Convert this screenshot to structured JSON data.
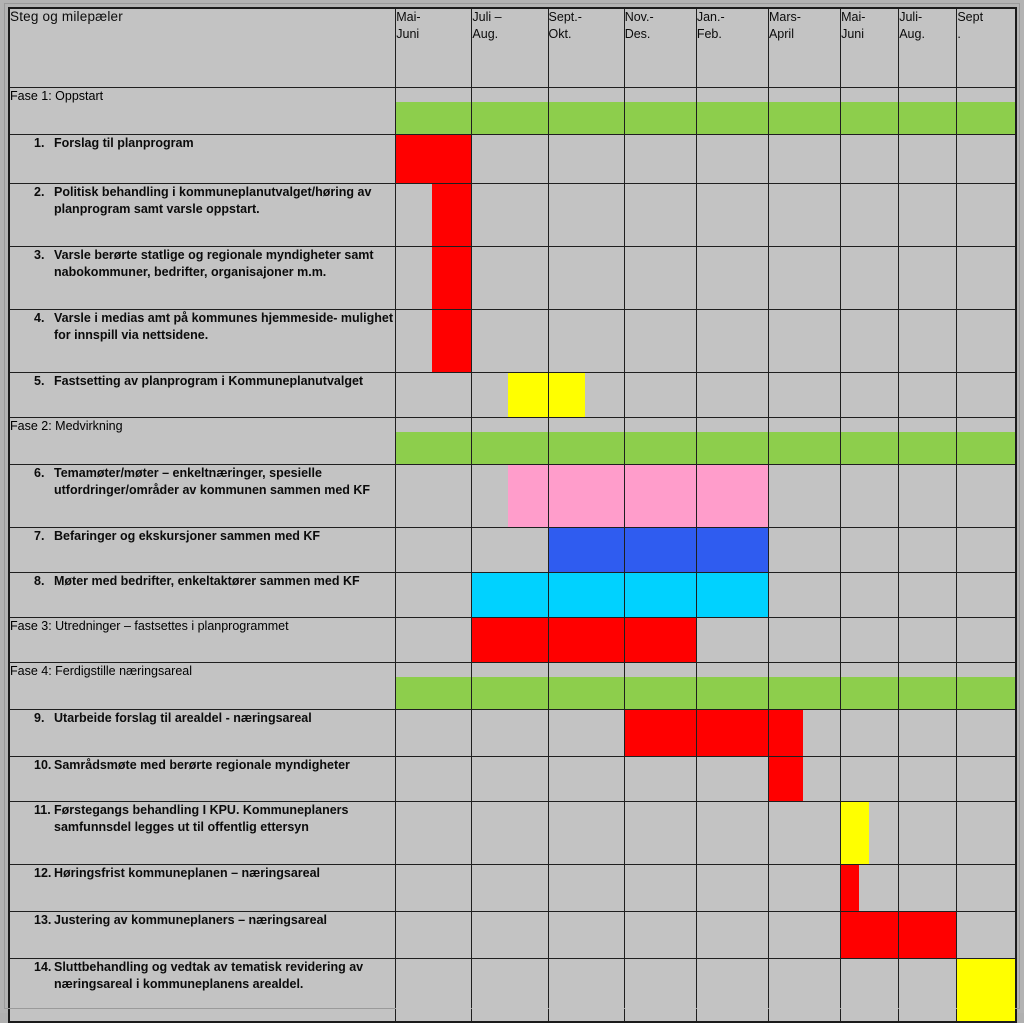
{
  "table": {
    "corner_header": "Steg og milepæler",
    "columns": [
      {
        "line1": "Mai-",
        "line2": "Juni"
      },
      {
        "line1": "Juli –",
        "line2": "Aug."
      },
      {
        "line1": "Sept.-",
        "line2": "Okt."
      },
      {
        "line1": "Nov.-",
        "line2": "Des."
      },
      {
        "line1": "Jan.-",
        "line2": "Feb."
      },
      {
        "line1": "Mars-",
        "line2": "April"
      },
      {
        "line1": "Mai-",
        "line2": "Juni"
      },
      {
        "line1": "Juli-",
        "line2": "Aug."
      },
      {
        "line1": "Sept",
        "line2": "."
      }
    ],
    "rows": [
      {
        "kind": "phase",
        "label": "Fase 1: Oppstart",
        "bars": [
          {
            "col": 1,
            "color": "#8DCE4C",
            "span": "full"
          },
          {
            "col": 2,
            "color": "#8DCE4C",
            "span": "full"
          },
          {
            "col": 3,
            "color": "#8DCE4C",
            "span": "full"
          },
          {
            "col": 4,
            "color": "#8DCE4C",
            "span": "full"
          },
          {
            "col": 5,
            "color": "#8DCE4C",
            "span": "full"
          },
          {
            "col": 6,
            "color": "#8DCE4C",
            "span": "full"
          },
          {
            "col": 7,
            "color": "#8DCE4C",
            "span": "full"
          },
          {
            "col": 8,
            "color": "#8DCE4C",
            "span": "full"
          },
          {
            "col": 9,
            "color": "#8DCE4C",
            "span": "full"
          }
        ]
      },
      {
        "kind": "task",
        "num": "1.",
        "label": "Forslag til planprogram",
        "height": 48,
        "bars": [
          {
            "col": 1,
            "color": "#FF0000",
            "span": "full"
          }
        ]
      },
      {
        "kind": "task",
        "num": "2.",
        "label": "Politisk behandling i kommuneplanutvalget/høring av planprogram samt varsle oppstart.",
        "height": 62,
        "bars": [
          {
            "col": 1,
            "color": "#FF0000",
            "span": "rhalf"
          }
        ]
      },
      {
        "kind": "task",
        "num": "3.",
        "label": "Varsle berørte statlige og regionale myndigheter samt nabokommuner, bedrifter, organisajoner m.m.",
        "height": 62,
        "bars": [
          {
            "col": 1,
            "color": "#FF0000",
            "span": "rhalf"
          }
        ]
      },
      {
        "kind": "task",
        "num": "4.",
        "label": "Varsle i medias amt på kommunes hjemmeside- mulighet for innspill via nettsidene.",
        "height": 62,
        "bars": [
          {
            "col": 1,
            "color": "#FF0000",
            "span": "rhalf"
          }
        ]
      },
      {
        "kind": "task",
        "num": "5.",
        "label": "Fastsetting av planprogram i Kommuneplanutvalget",
        "height": 44,
        "bars": [
          {
            "col": 2,
            "color": "#FFFF00",
            "span": "rhalf"
          },
          {
            "col": 3,
            "color": "#FFFF00",
            "span": "lhalf"
          }
        ]
      },
      {
        "kind": "phase",
        "label": "Fase 2: Medvirkning",
        "bars": [
          {
            "col": 1,
            "color": "#8DCE4C",
            "span": "full"
          },
          {
            "col": 2,
            "color": "#8DCE4C",
            "span": "full"
          },
          {
            "col": 3,
            "color": "#8DCE4C",
            "span": "full"
          },
          {
            "col": 4,
            "color": "#8DCE4C",
            "span": "full"
          },
          {
            "col": 5,
            "color": "#8DCE4C",
            "span": "full"
          },
          {
            "col": 6,
            "color": "#8DCE4C",
            "span": "full"
          },
          {
            "col": 7,
            "color": "#8DCE4C",
            "span": "full"
          },
          {
            "col": 8,
            "color": "#8DCE4C",
            "span": "full"
          },
          {
            "col": 9,
            "color": "#8DCE4C",
            "span": "full"
          }
        ]
      },
      {
        "kind": "task",
        "num": "6.",
        "label": "Temamøter/møter – enkeltnæringer, spesielle utfordringer/områder av kommunen sammen med KF",
        "height": 62,
        "bars": [
          {
            "col": 2,
            "color": "#FF9DCB",
            "span": "rhalf"
          },
          {
            "col": 3,
            "color": "#FF9DCB",
            "span": "full"
          },
          {
            "col": 4,
            "color": "#FF9DCB",
            "span": "full"
          },
          {
            "col": 5,
            "color": "#FF9DCB",
            "span": "full"
          }
        ]
      },
      {
        "kind": "task",
        "num": "7.",
        "label": "Befaringer og ekskursjoner sammen med KF",
        "height": 44,
        "bars": [
          {
            "col": 3,
            "color": "#2F5CF0",
            "span": "full"
          },
          {
            "col": 4,
            "color": "#2F5CF0",
            "span": "full"
          },
          {
            "col": 5,
            "color": "#2F5CF0",
            "span": "full"
          }
        ]
      },
      {
        "kind": "task",
        "num": "8.",
        "label": "Møter med bedrifter, enkeltaktører sammen med KF",
        "height": 44,
        "bars": [
          {
            "col": 2,
            "color": "#00D2FF",
            "span": "full"
          },
          {
            "col": 3,
            "color": "#00D2FF",
            "span": "full"
          },
          {
            "col": 4,
            "color": "#00D2FF",
            "span": "full"
          },
          {
            "col": 5,
            "color": "#00D2FF",
            "span": "full"
          }
        ]
      },
      {
        "kind": "phase-bar",
        "label": "Fase 3: Utredninger – fastsettes i planprogrammet",
        "height": 44,
        "bars": [
          {
            "col": 2,
            "color": "#FF0000",
            "span": "full"
          },
          {
            "col": 3,
            "color": "#FF0000",
            "span": "full"
          },
          {
            "col": 4,
            "color": "#FF0000",
            "span": "full"
          }
        ]
      },
      {
        "kind": "phase",
        "label": "Fase 4: Ferdigstille næringsareal",
        "bars": [
          {
            "col": 1,
            "color": "#8DCE4C",
            "span": "full"
          },
          {
            "col": 2,
            "color": "#8DCE4C",
            "span": "full"
          },
          {
            "col": 3,
            "color": "#8DCE4C",
            "span": "full"
          },
          {
            "col": 4,
            "color": "#8DCE4C",
            "span": "full"
          },
          {
            "col": 5,
            "color": "#8DCE4C",
            "span": "full"
          },
          {
            "col": 6,
            "color": "#8DCE4C",
            "span": "full"
          },
          {
            "col": 7,
            "color": "#8DCE4C",
            "span": "full"
          },
          {
            "col": 8,
            "color": "#8DCE4C",
            "span": "full"
          },
          {
            "col": 9,
            "color": "#8DCE4C",
            "span": "full"
          }
        ]
      },
      {
        "kind": "task",
        "num": "9.",
        "label": "Utarbeide forslag til arealdel - næringsareal",
        "height": 46,
        "bars": [
          {
            "col": 4,
            "color": "#FF0000",
            "span": "full"
          },
          {
            "col": 5,
            "color": "#FF0000",
            "span": "full"
          },
          {
            "col": 6,
            "color": "#FF0000",
            "span": "lhalf"
          }
        ]
      },
      {
        "kind": "task",
        "num": "10.",
        "label": "Samrådsmøte med berørte regionale myndigheter",
        "height": 44,
        "bars": [
          {
            "col": 6,
            "color": "#FF0000",
            "span": "lhalf"
          }
        ]
      },
      {
        "kind": "task",
        "num": "11.",
        "label": "Førstegangs behandling I KPU. Kommuneplaners samfunnsdel legges ut til offentlig ettersyn",
        "height": 62,
        "bars": [
          {
            "col": 7,
            "color": "#FFFF00",
            "span": "lhalf"
          }
        ]
      },
      {
        "kind": "task",
        "num": "12.",
        "label": "Høringsfrist kommuneplanen – næringsareal",
        "height": 46,
        "bars": [
          {
            "col": 7,
            "color": "#FF0000",
            "span": "lnarrow"
          }
        ]
      },
      {
        "kind": "task",
        "num": "13.",
        "label": "Justering av kommuneplaners – næringsareal",
        "height": 46,
        "bars": [
          {
            "col": 7,
            "color": "#FF0000",
            "span": "full"
          },
          {
            "col": 8,
            "color": "#FF0000",
            "span": "full"
          }
        ]
      },
      {
        "kind": "task",
        "num": "14.",
        "label": "Sluttbehandling og vedtak av tematisk revidering av næringsareal i kommuneplanens arealdel.",
        "height": 62,
        "bars": [
          {
            "col": 9,
            "color": "#FFFF00",
            "span": "full"
          }
        ]
      }
    ]
  }
}
